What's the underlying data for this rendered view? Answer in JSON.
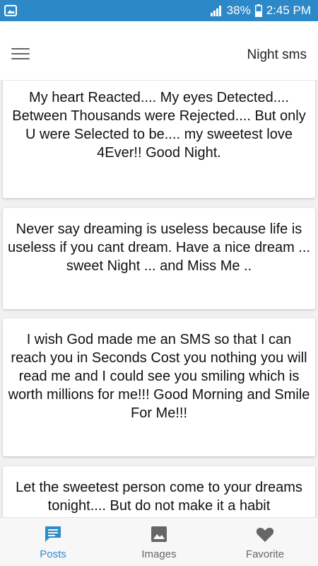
{
  "status_bar": {
    "battery_percent": "38%",
    "time": "2:45 PM"
  },
  "app_bar": {
    "title": "Night sms"
  },
  "posts": [
    {
      "text": "My heart Reacted.... My eyes Detected.... Between Thousands were Rejected.... But only U were Selected to be.... my sweetest love 4Ever!! Good Night."
    },
    {
      "text": "Never say dreaming is useless because life is useless if you cant dream. Have a nice dream ... sweet Night ... and Miss Me .."
    },
    {
      "text": "I wish God made me an SMS so that I can reach you in Seconds Cost you nothing you will read me and I could see you smiling which is worth millions for me!!! Good Morning and Smile For Me!!!"
    },
    {
      "text": "Let the sweetest person come to your dreams tonight.... But do not make it a habit"
    }
  ],
  "bottom_nav": {
    "items": [
      {
        "label": "Posts",
        "icon": "chat-bubble-icon",
        "active": true
      },
      {
        "label": "Images",
        "icon": "image-icon",
        "active": false
      },
      {
        "label": "Favorite",
        "icon": "heart-icon",
        "active": false
      }
    ]
  },
  "colors": {
    "status_bar": "#2c88c7",
    "accent": "#2d8ccd",
    "inactive_icon": "#666666"
  }
}
